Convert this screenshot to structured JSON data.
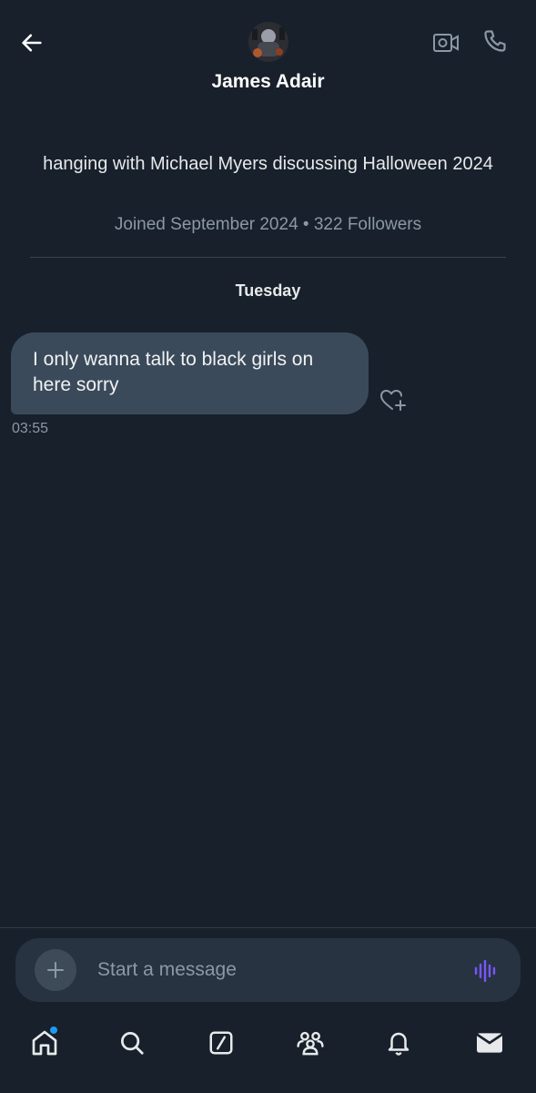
{
  "header": {
    "contact_name": "James Adair",
    "icons": {
      "back": "arrow-left-icon",
      "video": "video-camera-icon",
      "call": "phone-icon"
    }
  },
  "profile": {
    "bio": "hanging with Michael Myers discussing Halloween 2024",
    "meta": "Joined September 2024 • 322 Followers"
  },
  "conversation": {
    "day_label": "Tuesday",
    "messages": [
      {
        "text": "I only wanna talk to black girls on here sorry",
        "time": "03:55"
      }
    ]
  },
  "composer": {
    "placeholder": "Start a message",
    "add_icon": "plus-icon",
    "voice_icon": "voice-waveform-icon",
    "voice_color": "#7856ff"
  },
  "bottom_nav": {
    "items": [
      "home-icon",
      "search-icon",
      "grok-icon",
      "communities-icon",
      "notifications-icon",
      "messages-icon"
    ],
    "accent_dot_color": "#1d9bf0"
  },
  "colors": {
    "background": "#17202b",
    "bubble": "#3b4a5a",
    "muted_text": "#8b98a5"
  }
}
